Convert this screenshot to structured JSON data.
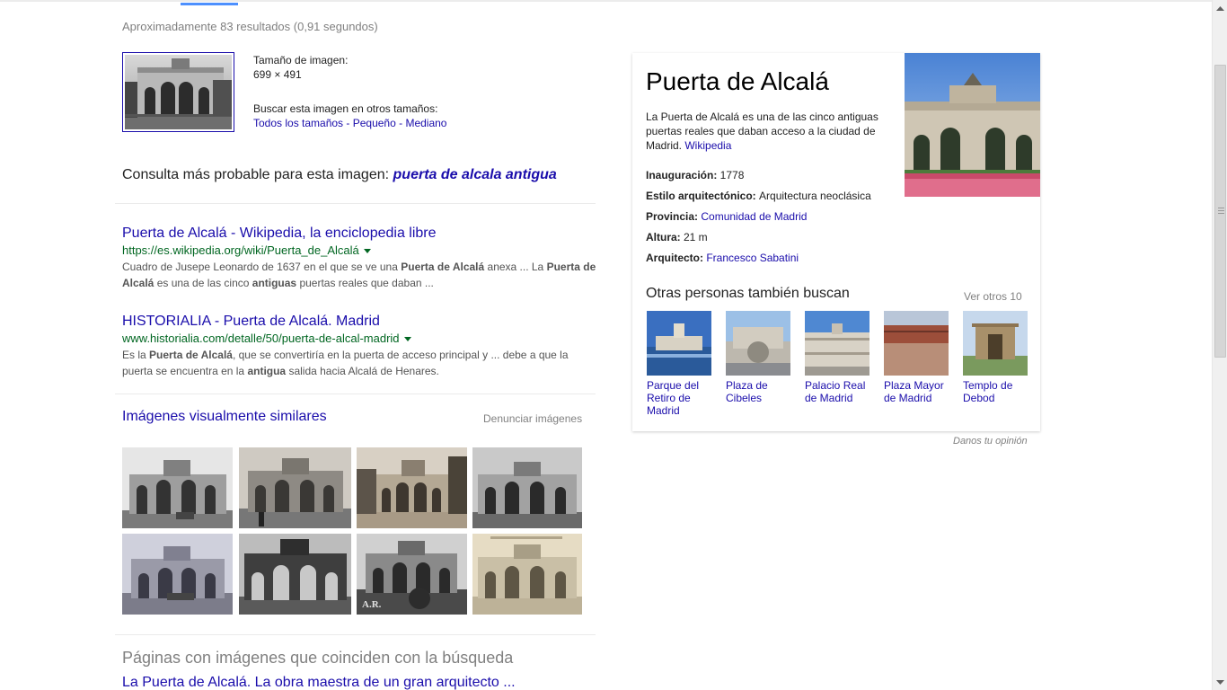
{
  "results_count": "Aproximadamente 83 resultados (0,91 segundos)",
  "image_info": {
    "size_label": "Tamaño de imagen:",
    "size_value": "699 × 491",
    "other_sizes_label": "Buscar esta imagen en otros tamaños:",
    "size_links": [
      "Todos los tamaños",
      "Pequeño",
      "Mediano"
    ],
    "separator": " - "
  },
  "probable_query": {
    "label": "Consulta más probable para esta imagen: ",
    "query": "puerta de alcala antigua"
  },
  "results": [
    {
      "title": "Puerta de Alcalá - Wikipedia, la enciclopedia libre",
      "url": "https://es.wikipedia.org/wiki/Puerta_de_Alcalá",
      "snippet_parts": [
        {
          "t": "Cuadro de Jusepe Leonardo de 1637 en el que se ve una ",
          "b": false
        },
        {
          "t": "Puerta de Alcalá",
          "b": true
        },
        {
          "t": " anexa ... La ",
          "b": false
        },
        {
          "t": "Puerta de Alcalá",
          "b": true
        },
        {
          "t": " es una de las cinco ",
          "b": false
        },
        {
          "t": "antiguas",
          "b": true
        },
        {
          "t": " puertas reales que daban ...",
          "b": false
        }
      ]
    },
    {
      "title": "HISTORIALIA - Puerta de Alcalá. Madrid",
      "url": "www.historialia.com/detalle/50/puerta-de-alcal-madrid",
      "snippet_parts": [
        {
          "t": "Es la ",
          "b": false
        },
        {
          "t": "Puerta de Alcalá",
          "b": true
        },
        {
          "t": ", que se convertiría en la puerta de acceso principal y ... debe a que la puerta se encuentra en la ",
          "b": false
        },
        {
          "t": "antigua",
          "b": true
        },
        {
          "t": " salida hacia Alcalá de Henares.",
          "b": false
        }
      ]
    }
  ],
  "similar": {
    "title": "Imágenes visualmente similares",
    "report": "Denunciar imágenes"
  },
  "pages": {
    "title": "Páginas con imágenes que coinciden con la búsqueda",
    "first_link": "La Puerta de Alcalá. La obra maestra de un gran arquitecto ..."
  },
  "knowledge_panel": {
    "title": "Puerta de Alcalá",
    "description": "La Puerta de Alcalá es una de las cinco antiguas puertas reales que daban acceso a la ciudad de Madrid. ",
    "source": "Wikipedia",
    "facts": [
      {
        "label": "Inauguración:",
        "value": "1778",
        "link": false
      },
      {
        "label": "Estilo arquitectónico:",
        "value": "Arquitectura neoclásica",
        "link": false
      },
      {
        "label": "Provincia:",
        "value": "Comunidad de Madrid",
        "link": true
      },
      {
        "label": "Altura:",
        "value": "21 m",
        "link": false
      },
      {
        "label": "Arquitecto:",
        "value": "Francesco Sabatini",
        "link": true
      }
    ],
    "others_title": "Otras personas también buscan",
    "see_more": "Ver otros 10",
    "others": [
      {
        "label": "Parque del Retiro de Madrid"
      },
      {
        "label": "Plaza de Cibeles"
      },
      {
        "label": "Palacio Real de Madrid"
      },
      {
        "label": "Plaza Mayor de Madrid"
      },
      {
        "label": "Templo de Debod"
      }
    ]
  },
  "feedback": "Danos tu opinión",
  "icons": {
    "scroll_up": "triangle-up-icon",
    "scroll_down": "triangle-down-icon",
    "url_menu": "caret-down-icon"
  }
}
